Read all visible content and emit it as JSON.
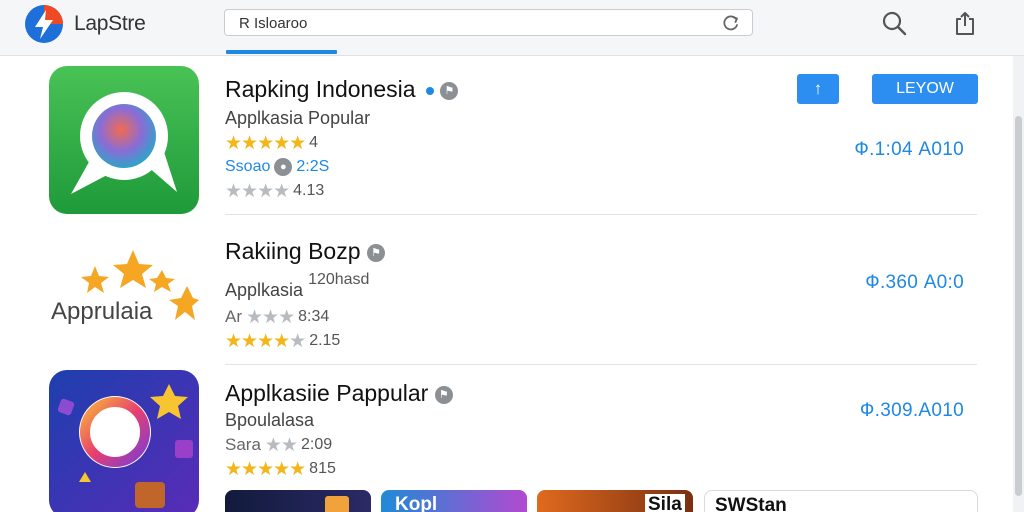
{
  "header": {
    "brand": "LapStre",
    "search_value": "R Isloaroo",
    "search_placeholder": "Search"
  },
  "actions": {
    "square_button": "↑",
    "primary_button": "LEYOW"
  },
  "apps": [
    {
      "name": "Rapking Indonesia",
      "subtitle": "Applkasia Popular",
      "rating_value": "4",
      "meta_prefix": "Ssoao",
      "meta_value": "2:2S",
      "secondary_value": "4.13",
      "price": "Ф.1:04 A010"
    },
    {
      "name": "Rakiing Bozp",
      "subtitle": "Applkasia",
      "subtitle_extra": "120hasd",
      "icon_label": "Apprulaia",
      "meta_prefix": "Ar",
      "meta_value": "8:34",
      "secondary_value": "2.15",
      "price": "Ф.360 A0:0"
    },
    {
      "name": "Applkasiie Pappular",
      "subtitle": "Bpoulalasa",
      "meta_prefix": "Sara",
      "meta_value": "2:09",
      "secondary_value": "815",
      "price": "Ф.309.A010"
    }
  ],
  "thumbnails": [
    {
      "label": ""
    },
    {
      "label": "Kopl"
    },
    {
      "label": "Sila"
    },
    {
      "label": "SWStan"
    }
  ],
  "colors": {
    "accent": "#1e88e5",
    "star": "#f2b619",
    "button": "#2b8ef0"
  }
}
